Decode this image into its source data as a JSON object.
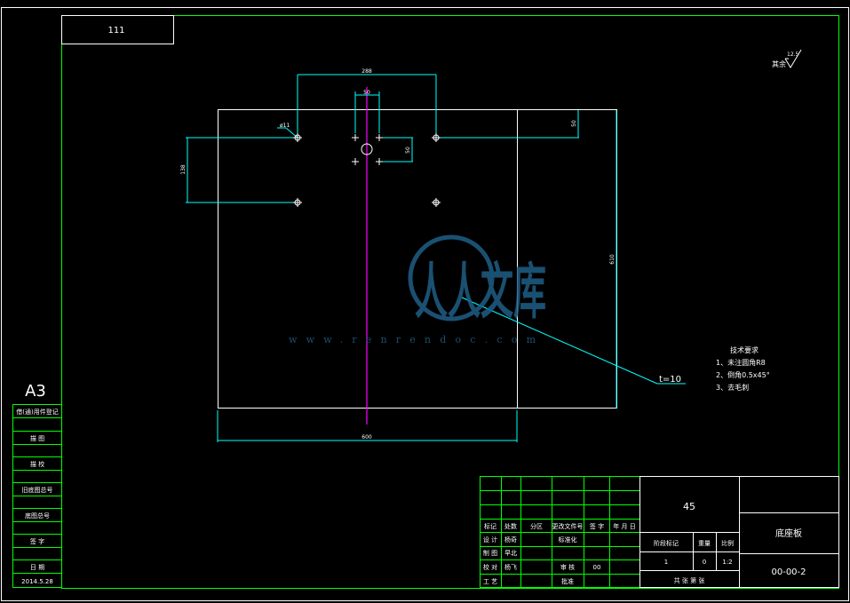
{
  "drawing": {
    "code_box": "111",
    "roughness_value": "12.5",
    "roughness_label": "其余",
    "dims": {
      "top_span": "288",
      "center_width": "50",
      "small_vertical": "50",
      "right_top": "50",
      "left_vertical": "138",
      "hole_callout": "ø11",
      "right_height": "610",
      "bottom_width": "600",
      "thickness": "t=10"
    },
    "tech_requirements": {
      "title": "技术要求",
      "items": [
        "1、未注圆角R8",
        "2、倒角0.5x45°",
        "3、去毛刺"
      ]
    }
  },
  "left_strip": {
    "paper_size": "A3",
    "rows": [
      "借(通)用件登记",
      "描 图",
      "描 校",
      "旧底图总号",
      "底图总号",
      "签 字",
      "日 期"
    ],
    "date": "2014.5.28"
  },
  "title_block": {
    "rev_headers": [
      "标记",
      "处数",
      "分区",
      "更改文件号",
      "签 字",
      "年 月 日"
    ],
    "role_rows": [
      [
        "设 计",
        "杨奇",
        "标准化"
      ],
      [
        "制 图",
        "早北",
        ""
      ],
      [
        "校 对",
        "杨飞",
        "审 核",
        "00"
      ],
      [
        "工 艺",
        "",
        "批准"
      ]
    ],
    "material": "45",
    "stage_headers": [
      "阶段标记",
      "重量",
      "比例"
    ],
    "stage_values": [
      "1",
      "0",
      "1:2"
    ],
    "sheet_info": "共 张 第 张",
    "part_name": "底座板",
    "drawing_no": "00-00-2"
  },
  "watermark": {
    "text": "人人文库",
    "url": "www.renrendoc.com"
  },
  "colors": {
    "background": "#000000",
    "frame": "#00ff00",
    "geometry": "#ffffff",
    "dimension": "#00ffff",
    "centerline": "#ff00ff",
    "watermark": "#1f5f86"
  }
}
